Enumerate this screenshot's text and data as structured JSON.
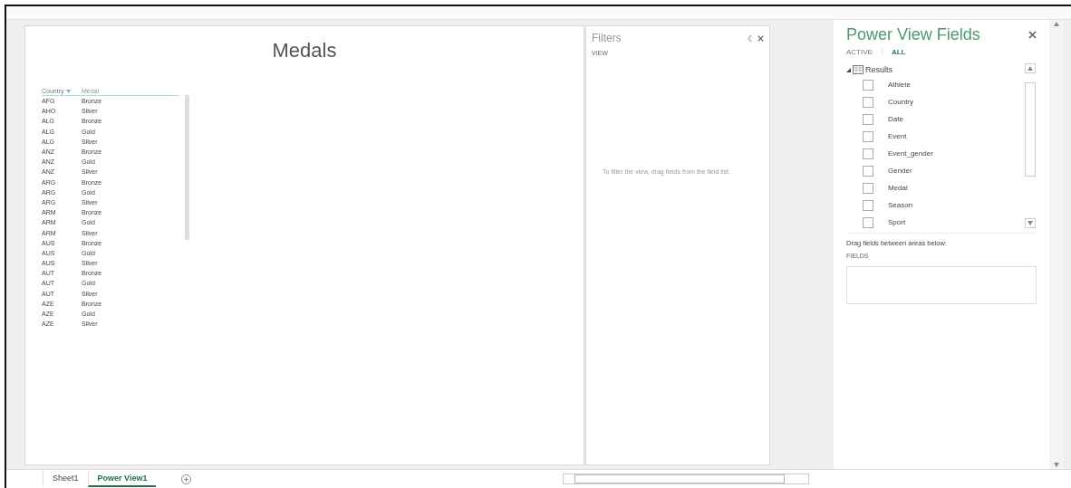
{
  "report": {
    "title": "Medals",
    "table": {
      "columns": [
        {
          "label": "Country",
          "sorted": true
        },
        {
          "label": "Medal",
          "sorted": false
        }
      ],
      "rows": [
        [
          "AFG",
          "Bronze"
        ],
        [
          "AHO",
          "Silver"
        ],
        [
          "ALG",
          "Bronze"
        ],
        [
          "ALG",
          "Gold"
        ],
        [
          "ALG",
          "Silver"
        ],
        [
          "ANZ",
          "Bronze"
        ],
        [
          "ANZ",
          "Gold"
        ],
        [
          "ANZ",
          "Silver"
        ],
        [
          "ARG",
          "Bronze"
        ],
        [
          "ARG",
          "Gold"
        ],
        [
          "ARG",
          "Silver"
        ],
        [
          "ARM",
          "Bronze"
        ],
        [
          "ARM",
          "Gold"
        ],
        [
          "ARM",
          "Silver"
        ],
        [
          "AUS",
          "Bronze"
        ],
        [
          "AUS",
          "Gold"
        ],
        [
          "AUS",
          "Silver"
        ],
        [
          "AUT",
          "Bronze"
        ],
        [
          "AUT",
          "Gold"
        ],
        [
          "AUT",
          "Silver"
        ],
        [
          "AZE",
          "Bronze"
        ],
        [
          "AZE",
          "Gold"
        ],
        [
          "AZE",
          "Silver"
        ]
      ]
    }
  },
  "filters": {
    "title": "Filters",
    "section": "VIEW",
    "hint": "To filter the view, drag fields from the field list."
  },
  "fields_pane": {
    "title": "Power View Fields",
    "tabs": [
      {
        "label": "ACTIVE",
        "selected": false
      },
      {
        "label": "ALL",
        "selected": true
      }
    ],
    "table": {
      "name": "Results",
      "expanded": true,
      "fields": [
        {
          "label": "Athlete",
          "checked": false
        },
        {
          "label": "Country",
          "checked": false
        },
        {
          "label": "Date",
          "checked": false
        },
        {
          "label": "Event",
          "checked": false
        },
        {
          "label": "Event_gender",
          "checked": false
        },
        {
          "label": "Gender",
          "checked": false
        },
        {
          "label": "Medal",
          "checked": false
        },
        {
          "label": "Season",
          "checked": false
        },
        {
          "label": "Sport",
          "checked": false
        }
      ]
    },
    "drag_hint": "Drag fields between areas below:",
    "area_label": "FIELDS"
  },
  "sheet_tabs": [
    {
      "label": "Sheet1",
      "selected": false
    },
    {
      "label": "Power View1",
      "selected": true
    }
  ]
}
